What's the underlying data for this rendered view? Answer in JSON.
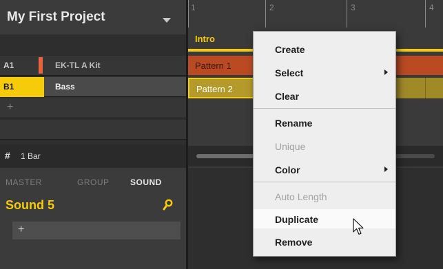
{
  "project": {
    "title": "My First Project"
  },
  "groups": [
    {
      "slot": "A1",
      "name": "EK-TL A Kit",
      "color": "#e8643c"
    },
    {
      "slot": "B1",
      "name": "Bass",
      "color": "#f5cb0a"
    }
  ],
  "groups_add_label": "+",
  "pattern_length": {
    "icon": "grid-icon",
    "glyph": "#",
    "label": "1 Bar"
  },
  "sound_panel": {
    "tabs": [
      "MASTER",
      "GROUP",
      "SOUND"
    ],
    "selected_tab": "SOUND",
    "sound_name": "Sound 5",
    "add_label": "+"
  },
  "ruler": {
    "bars": [
      "1",
      "2",
      "3",
      "4"
    ]
  },
  "scene": {
    "name": "Intro"
  },
  "patterns": [
    {
      "name": "Pattern 1",
      "color": "#b94a22"
    },
    {
      "name": "Pattern 2",
      "color": "#b39a2a",
      "selected": true
    }
  ],
  "context_menu": {
    "items": [
      {
        "label": "Create",
        "enabled": true,
        "submenu": false
      },
      {
        "label": "Select",
        "enabled": true,
        "submenu": true
      },
      {
        "label": "Clear",
        "enabled": true,
        "submenu": false
      },
      {
        "label": "Rename",
        "enabled": true,
        "submenu": false
      },
      {
        "label": "Unique",
        "enabled": false,
        "submenu": false
      },
      {
        "label": "Color",
        "enabled": true,
        "submenu": true
      },
      {
        "label": "Auto Length",
        "enabled": false,
        "submenu": false
      },
      {
        "label": "Duplicate",
        "enabled": true,
        "submenu": false,
        "hovered": true
      },
      {
        "label": "Remove",
        "enabled": true,
        "submenu": false
      }
    ]
  },
  "colors": {
    "accent": "#f5cb0a",
    "group_a": "#e8643c",
    "background": "#2a2a2a"
  }
}
